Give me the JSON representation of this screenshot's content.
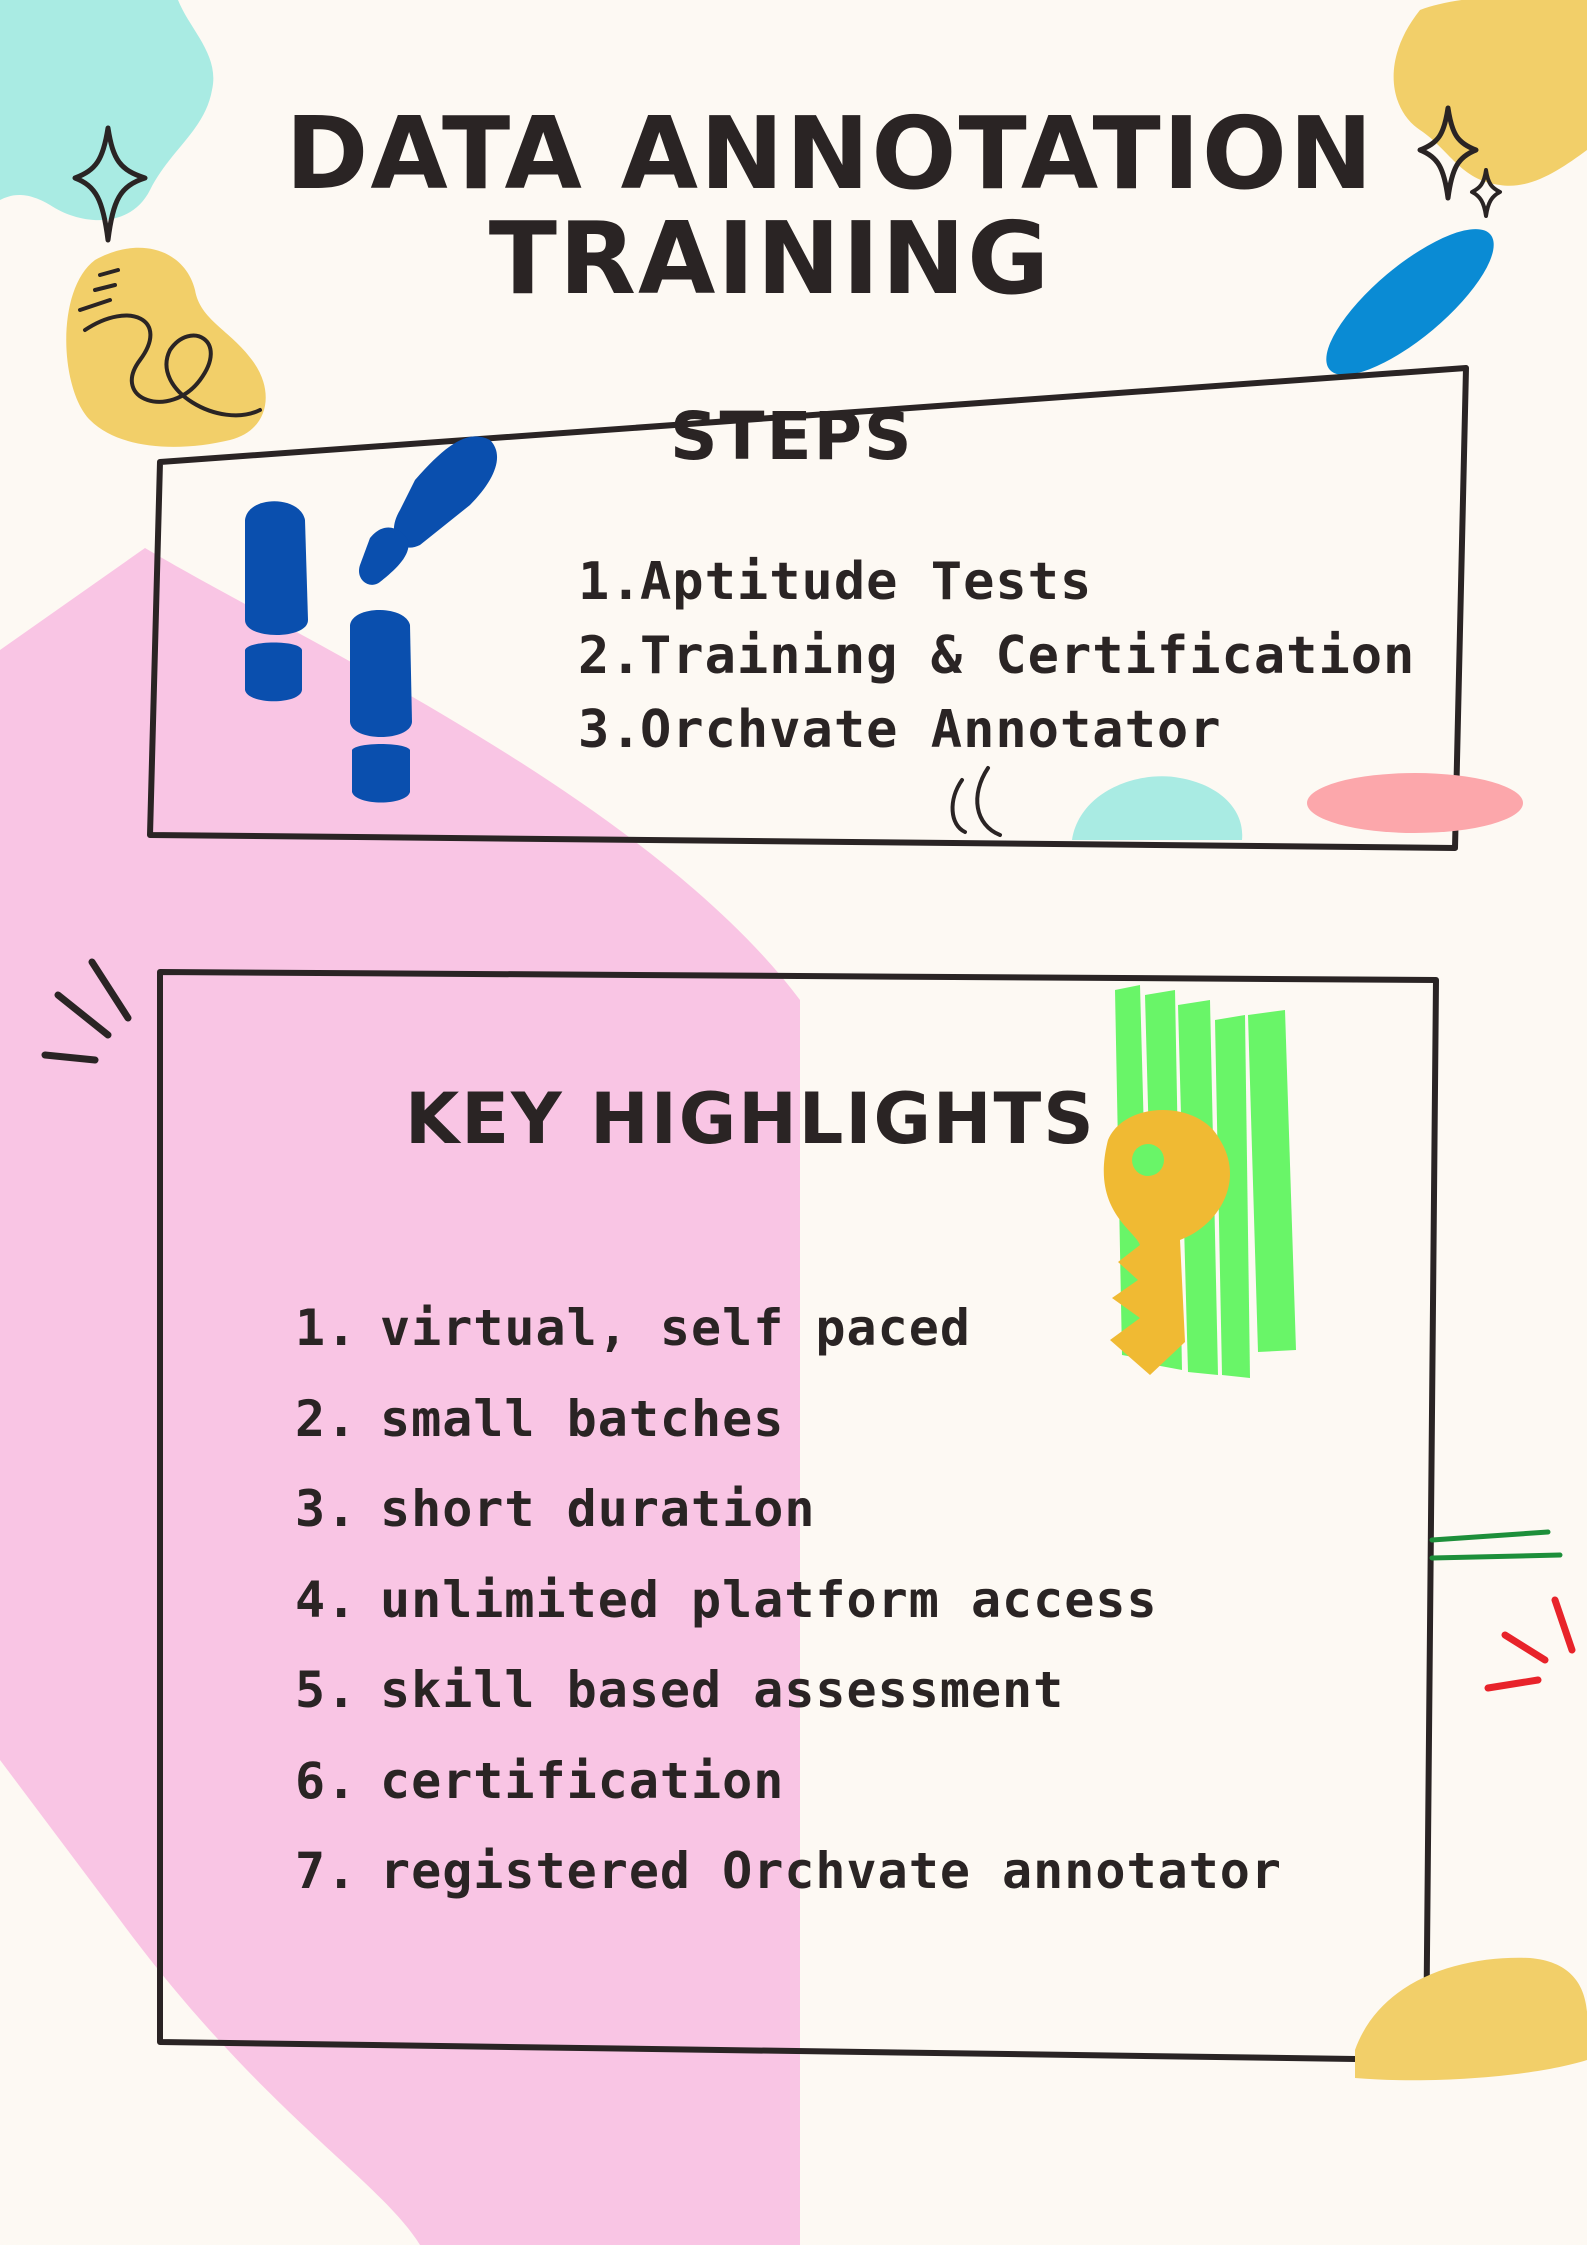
{
  "header": {
    "title_line1": "DATA ANNOTATION",
    "title_line2": "TRAINING"
  },
  "steps": {
    "title": "STEPS",
    "items": [
      {
        "num": "1.",
        "text": "Aptitude Tests"
      },
      {
        "num": "2.",
        "text": "Training & Certification"
      },
      {
        "num": "3.",
        "text": "Orchvate Annotator"
      }
    ]
  },
  "highlights": {
    "title": "KEY HIGHLIGHTS",
    "items": [
      {
        "num": "1.",
        "text": "virtual, self paced"
      },
      {
        "num": "2.",
        "text": "small batches"
      },
      {
        "num": "3.",
        "text": "short duration"
      },
      {
        "num": "4.",
        "text": "unlimited platform access"
      },
      {
        "num": "5.",
        "text": "skill based assessment"
      },
      {
        "num": "6.",
        "text": "certification"
      },
      {
        "num": "7.",
        "text": "registered Orchvate annotator"
      }
    ]
  },
  "colors": {
    "background": "#fdf9f3",
    "text": "#2a2424",
    "pink": "#f9c5e4",
    "mint": "#a9ebe3",
    "yellow": "#f2cf69",
    "blue": "#0a8bd4",
    "navy": "#0a4fae",
    "green": "#69f568",
    "key": "#f0ba33",
    "coral": "#fca7ab",
    "red": "#e8232a",
    "dark_green": "#1d8f3a"
  },
  "icons": [
    "sparkle-icon",
    "footprints-icon",
    "key-icon"
  ]
}
